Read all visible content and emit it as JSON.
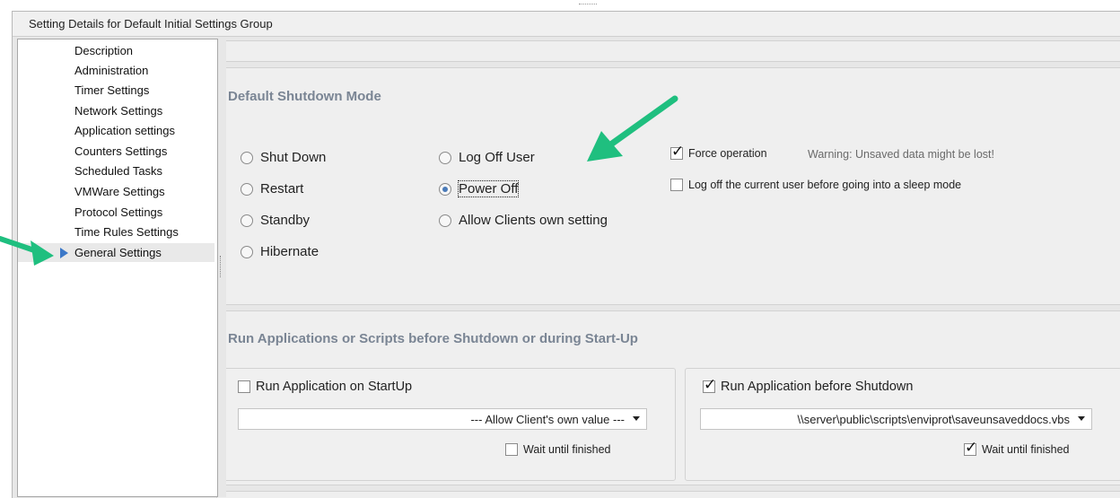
{
  "window": {
    "title": "Setting Details for Default Initial Settings Group"
  },
  "sidebar": {
    "items": [
      {
        "label": "Description"
      },
      {
        "label": "Administration"
      },
      {
        "label": "Timer Settings"
      },
      {
        "label": "Network Settings"
      },
      {
        "label": "Application settings"
      },
      {
        "label": "Counters Settings"
      },
      {
        "label": "Scheduled Tasks"
      },
      {
        "label": "VMWare Settings"
      },
      {
        "label": "Protocol Settings"
      },
      {
        "label": "Time Rules Settings"
      },
      {
        "label": "General Settings"
      }
    ],
    "selected": "General Settings"
  },
  "shutdown": {
    "title": "Default Shutdown Mode",
    "options": [
      {
        "label": "Shut Down",
        "selected": false
      },
      {
        "label": "Restart",
        "selected": false
      },
      {
        "label": "Standby",
        "selected": false
      },
      {
        "label": "Hibernate",
        "selected": false
      },
      {
        "label": "Log Off User",
        "selected": false
      },
      {
        "label": "Power Off",
        "selected": true
      },
      {
        "label": "Allow Clients own setting",
        "selected": false
      }
    ],
    "force_operation": {
      "label": "Force operation",
      "checked": true
    },
    "warning": "Warning: Unsaved data might be lost!",
    "logoff_sleep": {
      "label": "Log off the current user before going into a sleep mode",
      "checked": false
    }
  },
  "run_apps": {
    "title": "Run Applications or Scripts before Shutdown or during Start-Up",
    "startup": {
      "label": "Run Application on  StartUp",
      "checked": false,
      "combo_value": "--- Allow Client's own value ---",
      "wait_label": "Wait until finished",
      "wait_checked": false
    },
    "shutdown": {
      "label": "Run Application before Shutdown",
      "checked": true,
      "combo_value": "\\\\server\\public\\scripts\\enviprot\\saveunsaveddocs.vbs",
      "wait_label": "Wait until finished",
      "wait_checked": true
    }
  },
  "colors": {
    "annotation_arrow": "#1fbf7f",
    "selection_arrow": "#3c78c8",
    "group_title": "#7a8594"
  }
}
